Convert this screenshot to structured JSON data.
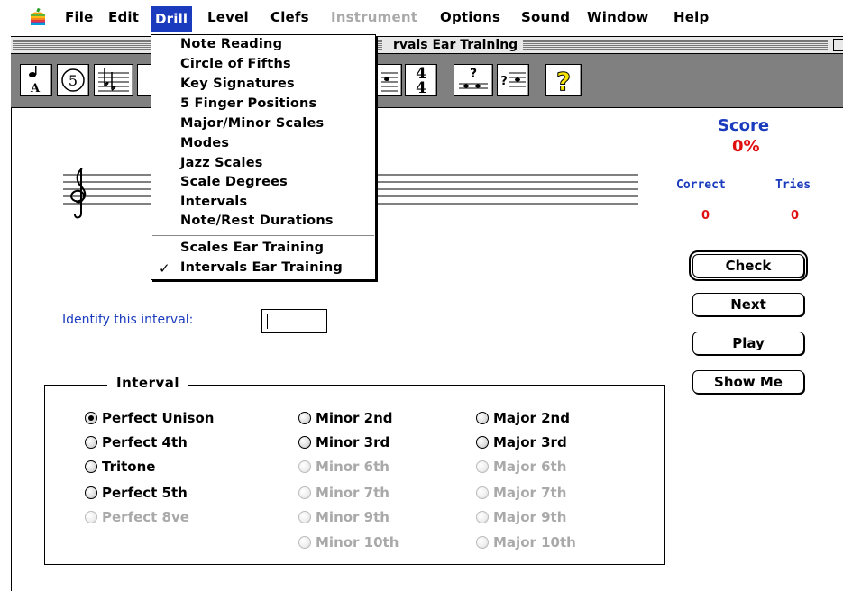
{
  "menubar": {
    "items": [
      {
        "label": "File",
        "enabled": true
      },
      {
        "label": "Edit",
        "enabled": true
      },
      {
        "label": "Drill",
        "enabled": true,
        "active": true
      },
      {
        "label": "Level",
        "enabled": true
      },
      {
        "label": "Clefs",
        "enabled": true
      },
      {
        "label": "Instrument",
        "enabled": false
      },
      {
        "label": "Options",
        "enabled": true
      },
      {
        "label": "Sound",
        "enabled": true
      },
      {
        "label": "Window",
        "enabled": true
      },
      {
        "label": "Help",
        "enabled": true
      }
    ]
  },
  "window": {
    "title": "rvals Ear Training"
  },
  "toolbar": {
    "note_letter": "A",
    "circle_number": "5",
    "time_sig_top": "4",
    "time_sig_bottom": "4",
    "help_glyph": "?",
    "quiz_glyph": "?"
  },
  "drill_menu": {
    "items": [
      "Note Reading",
      "Circle of Fifths",
      "Key Signatures",
      "5 Finger Positions",
      "Major/Minor Scales",
      "Modes",
      "Jazz Scales",
      "Scale Degrees",
      "Intervals",
      "Note/Rest Durations"
    ],
    "ear_items": [
      {
        "label": "Scales Ear Training",
        "checked": false
      },
      {
        "label": "Intervals Ear Training",
        "checked": true
      }
    ],
    "check_mark": "✓"
  },
  "score": {
    "title": "Score",
    "percent": "0%",
    "correct_label": "Correct",
    "tries_label": "Tries",
    "correct_value": "0",
    "tries_value": "0"
  },
  "buttons": {
    "check": "Check",
    "next": "Next",
    "play": "Play",
    "show_me": "Show Me"
  },
  "prompt": {
    "label": "Identify this interval:",
    "answer_value": ""
  },
  "interval_group": {
    "legend": "Interval",
    "columns": [
      [
        {
          "label": "Perfect Unison",
          "checked": true,
          "enabled": true
        },
        {
          "label": "Perfect 4th",
          "checked": false,
          "enabled": true
        },
        {
          "label": "Tritone",
          "checked": false,
          "enabled": true
        },
        {
          "label": "Perfect 5th",
          "checked": false,
          "enabled": true
        },
        {
          "label": "Perfect 8ve",
          "checked": false,
          "enabled": false
        }
      ],
      [
        {
          "label": "Minor 2nd",
          "checked": false,
          "enabled": true
        },
        {
          "label": "Minor 3rd",
          "checked": false,
          "enabled": true
        },
        {
          "label": "Minor 6th",
          "checked": false,
          "enabled": false
        },
        {
          "label": "Minor 7th",
          "checked": false,
          "enabled": false
        },
        {
          "label": "Minor 9th",
          "checked": false,
          "enabled": false
        },
        {
          "label": "Minor 10th",
          "checked": false,
          "enabled": false
        }
      ],
      [
        {
          "label": "Major 2nd",
          "checked": false,
          "enabled": true
        },
        {
          "label": "Major 3rd",
          "checked": false,
          "enabled": true
        },
        {
          "label": "Major 6th",
          "checked": false,
          "enabled": false
        },
        {
          "label": "Major 7th",
          "checked": false,
          "enabled": false
        },
        {
          "label": "Major 9th",
          "checked": false,
          "enabled": false
        },
        {
          "label": "Major 10th",
          "checked": false,
          "enabled": false
        }
      ]
    ]
  },
  "colors": {
    "accent_blue": "#1a3bbd",
    "score_red": "#e01010",
    "disabled_gray": "#a9a9a9",
    "toolbar_gray": "#808080"
  }
}
